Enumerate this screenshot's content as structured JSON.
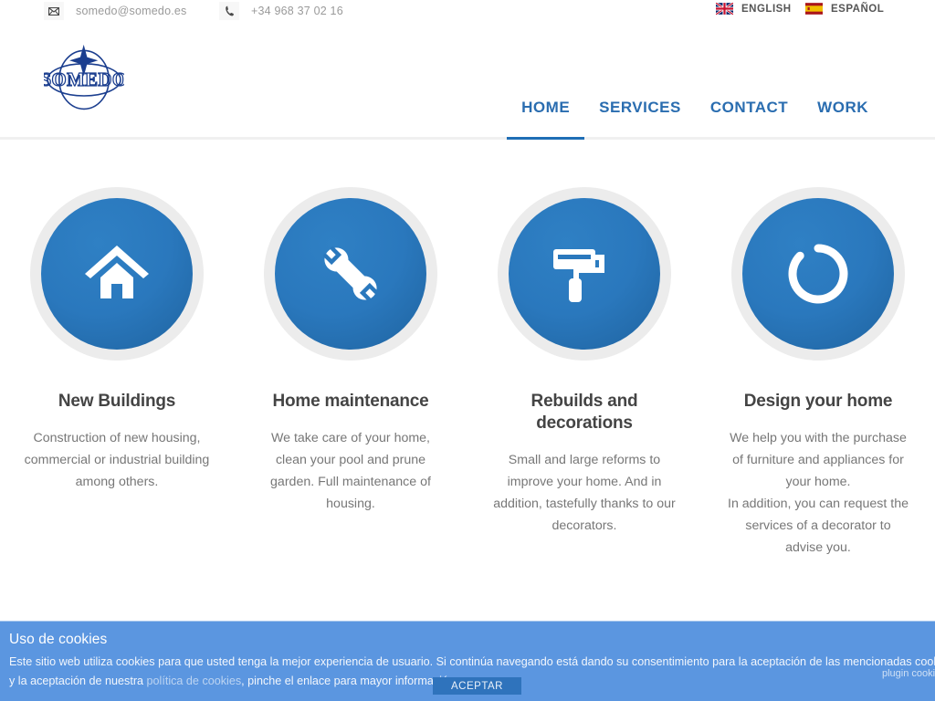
{
  "topbar": {
    "email": {
      "icon": "envelope-icon",
      "text": "somedo@somedo.es"
    },
    "phone": {
      "icon": "phone-icon",
      "text": "+34 968 37 02 16"
    },
    "languages": [
      {
        "code": "en",
        "label": "ENGLISH",
        "icon": "uk-flag-icon"
      },
      {
        "code": "es",
        "label": "ESPAÑOL",
        "icon": "spain-flag-icon"
      }
    ]
  },
  "header": {
    "logo_text": "SOMEDO",
    "nav": [
      {
        "label": "HOME",
        "active": true
      },
      {
        "label": "SERVICES",
        "active": false
      },
      {
        "label": "CONTACT",
        "active": false
      },
      {
        "label": "WORK",
        "active": false
      }
    ],
    "accent_color": "#2a6db0",
    "active_underline_color": "#1f6eb5"
  },
  "services": [
    {
      "icon": "house-icon",
      "title": "New Buildings",
      "text": "Construction of new housing, commercial or industrial building among others."
    },
    {
      "icon": "wrench-icon",
      "title": "Home maintenance",
      "text": "We take care of your home, clean your pool and prune garden. Full maintenance of housing."
    },
    {
      "icon": "paint-roller-icon",
      "title": "Rebuilds and decorations",
      "text": "Small and large reforms to improve your home. And in addition, tastefully thanks to our decorators."
    },
    {
      "icon": "circle-ring-icon",
      "title": "Design your home",
      "text": "We help you with the purchase of furniture and appliances for your home.\nIn addition, you can request the services of a decorator to advise you."
    }
  ],
  "cookie_banner": {
    "title": "Uso de cookies",
    "line1_before_link": "Este sitio web utiliza cookies para que usted tenga la mejor experiencia de usuario. Si continúa navegando está dando su consentimiento para la aceptación de las mencionadas cookies",
    "line2_before_link": "y la aceptación de nuestra ",
    "link_text": "política de cookies",
    "line2_after_link": ", pinche el enlace para mayor información.",
    "accept_label": "ACEPTAR",
    "plugin_label": "plugin cookies",
    "background_color": "#5b96e0",
    "button_color": "#2f73bc"
  }
}
